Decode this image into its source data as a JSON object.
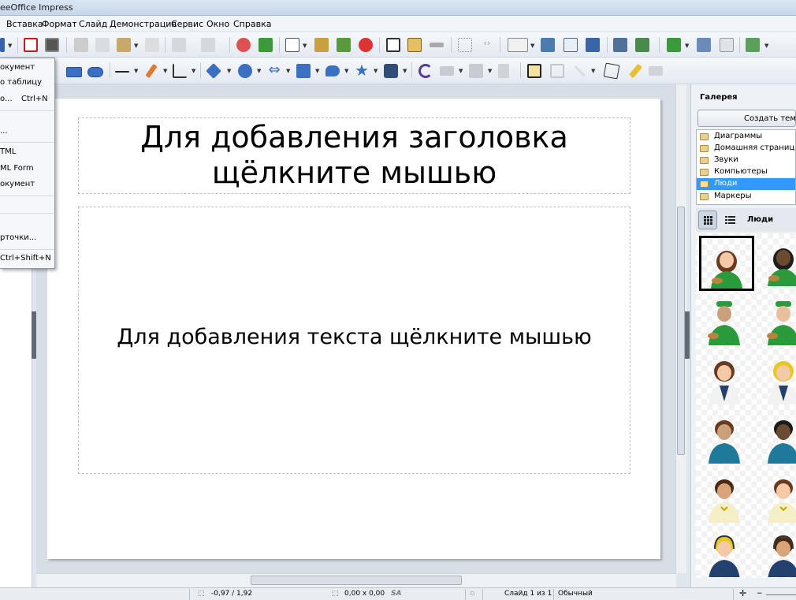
{
  "window": {
    "title": "eeOffice Impress"
  },
  "menu": {
    "items": [
      "Вставка",
      "Формат",
      "Слайд",
      "Демонстрация",
      "Сервис",
      "Окно",
      "Справка"
    ]
  },
  "dropdown": {
    "items": [
      {
        "label": "окумент",
        "shortcut": ""
      },
      {
        "label": "о таблицу",
        "shortcut": ""
      },
      {
        "label": "о...",
        "shortcut": "Ctrl+N"
      },
      {
        "label": "...",
        "shortcut": ""
      },
      {
        "label": "TML",
        "shortcut": ""
      },
      {
        "label": "ML Form",
        "shortcut": ""
      },
      {
        "label": "окумент",
        "shortcut": ""
      },
      {
        "label": "рточки...",
        "shortcut": ""
      },
      {
        "label": "",
        "shortcut": "Ctrl+Shift+N"
      }
    ]
  },
  "slide": {
    "title_placeholder": "Для добавления заголовка щёлкните мышью",
    "body_placeholder": "Для добавления текста щёлкните мышью"
  },
  "gallery": {
    "title": "Галерея",
    "new_theme_button": "Создать тему...",
    "themes": [
      "Диаграммы",
      "Домашняя страница",
      "Звуки",
      "Компьютеры",
      "Люди",
      "Маркеры"
    ],
    "selected_theme": "Люди",
    "current_theme_label": "Люди"
  },
  "status": {
    "position": "-0,97 / 1,92",
    "size": "0,00 x 0,00",
    "slide": "Слайд 1 из 1",
    "layout": "Обычный"
  },
  "colors": {
    "accent": "#3399ff",
    "window_bg": "#dfe6ee"
  },
  "icons": {
    "toolbar_standard": [
      "new-document-icon",
      "export-pdf-icon",
      "print-icon",
      "cut-icon",
      "copy-icon",
      "paste-icon",
      "clone-format-icon",
      "undo-icon",
      "redo-icon",
      "find-replace-icon",
      "spellcheck-icon",
      "table-icon",
      "image-icon",
      "chart-icon",
      "text-box-icon",
      "fontwork-icon",
      "hyperlink-icon",
      "grid-icon",
      "navigator-icon",
      "slide-layout-icon",
      "display-views-icon",
      "slide-show-icon",
      "new-slide-icon",
      "duplicate-slide-icon"
    ],
    "toolbar_drawing": [
      "line-icon",
      "rectangle-icon",
      "ellipse-icon",
      "arrow-line-icon",
      "freeform-icon",
      "connector-icon",
      "diamond-shape-icon",
      "smiley-shape-icon",
      "double-arrow-icon",
      "flowchart-icon",
      "callout-icon",
      "star-icon",
      "3d-object-icon",
      "rotate-icon",
      "align-icon",
      "arrange-icon",
      "distribute-icon",
      "shadow-icon",
      "crop-icon",
      "effects-icon",
      "points-icon",
      "glue-points-icon"
    ]
  }
}
